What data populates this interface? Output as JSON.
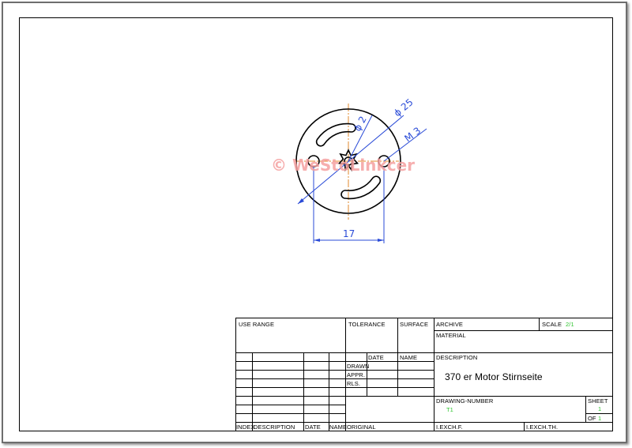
{
  "drawing": {
    "watermark": "© WeStoLinkcer",
    "dimensions": {
      "outer_diameter": "ϕ 25",
      "hole_diameter": "ϕ 2",
      "thread": "M 3",
      "spacing": "17"
    }
  },
  "title_block": {
    "use_range": "USE RANGE",
    "tolerance": "TOLERANCE",
    "surface": "SURFACE",
    "archive": "ARCHIVE",
    "scale_label": "SCALE",
    "scale_value": "2/1",
    "material": "MATERIAL",
    "date_header": "DATE",
    "name_header": "NAME",
    "drawn": "DRAWN",
    "approved": "APPR.",
    "released": "RLS.",
    "description_label": "DESCRIPTION",
    "description_value": "370 er Motor Stirnseite",
    "drawing_number_label": "DRAWING-NUMBER",
    "drawing_number_value": "T1",
    "sheet_label": "SHEET",
    "sheet_value": "1",
    "of_label": "OF",
    "of_value": "1",
    "footer": {
      "index": "INDEX",
      "description": "DESCRIPTION",
      "date": "DATE",
      "name": "NAME",
      "original": "ORIGINAL",
      "exch_f": "I.EXCH.F.",
      "exch_th": "I.EXCH.TH."
    }
  },
  "colors": {
    "dimension": "#2a4bd7",
    "centerline": "#e08a2c",
    "watermark": "#f4a0a0",
    "highlight_green": "#2ec52e"
  }
}
